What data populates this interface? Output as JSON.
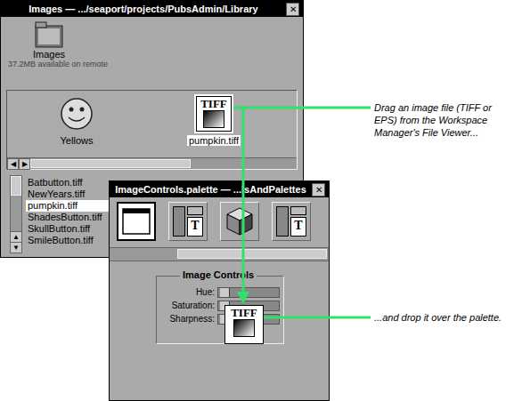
{
  "viewer_window": {
    "title": "Images — .../seaport/projects/PubsAdmin/Library",
    "close": "✕"
  },
  "folder": {
    "label": "Images",
    "status": "37.2MB available on remote"
  },
  "shelf": {
    "icons": [
      {
        "label": "Yellows",
        "kind": "smiley",
        "badge": "",
        "selected": false
      },
      {
        "label": "pumpkin.tiff",
        "kind": "tiff",
        "badge": "TIFF",
        "selected": true
      }
    ],
    "arrows": [
      "◀",
      "▶"
    ]
  },
  "files": {
    "items": [
      {
        "label": "Batbutton.tiff",
        "selected": false
      },
      {
        "label": "NewYears.tiff",
        "selected": false
      },
      {
        "label": "pumpkin.tiff",
        "selected": true
      },
      {
        "label": "ShadesButton.tiff",
        "selected": false
      },
      {
        "label": "SkullButton.tiff",
        "selected": false
      },
      {
        "label": "SmileButton.tiff",
        "selected": false
      }
    ],
    "arrows": [
      "▲",
      "▼"
    ]
  },
  "palette_window": {
    "title": "ImageControls.palette — ...lsAndPalettes",
    "close": "✕"
  },
  "toolbar": [
    {
      "kind": "window",
      "glyph": "",
      "selected": true
    },
    {
      "kind": "text-panel",
      "glyph": "T",
      "selected": false
    },
    {
      "kind": "cube",
      "glyph": "",
      "selected": false
    },
    {
      "kind": "text-panel",
      "glyph": "T",
      "selected": false
    }
  ],
  "image_controls": {
    "title": "Image Controls",
    "sliders": [
      {
        "label": "Hue:",
        "level": 0.1
      },
      {
        "label": "Saturation:",
        "level": 0.1
      },
      {
        "label": "Sharpness:",
        "level": 0.1
      }
    ]
  },
  "dragged_icon": {
    "badge": "TIFF"
  },
  "callouts": [
    {
      "text": "Drag an image file (TIFF or EPS) from the Workspace Manager's File Viewer..."
    },
    {
      "text": "...and drop it over the palette."
    }
  ]
}
